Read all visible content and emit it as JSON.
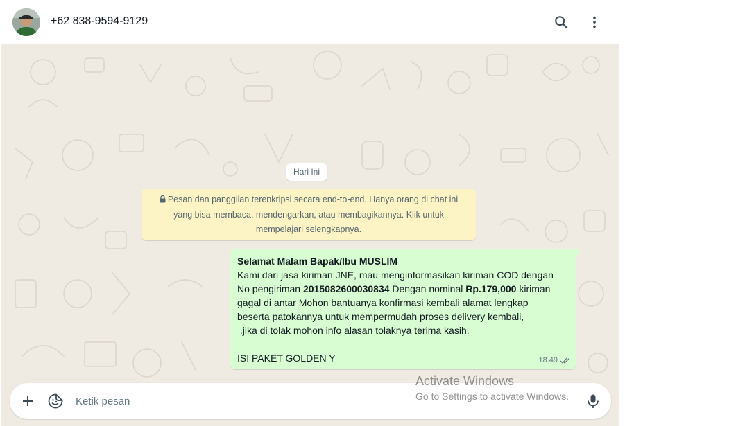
{
  "header": {
    "contact_name": "+62 838-9594-9129",
    "avatar_icon": "user-photo",
    "search_icon": "search-icon",
    "menu_icon": "more-vertical-icon"
  },
  "conversation": {
    "date_chip": "Hari Ini",
    "encryption_notice": {
      "icon": "lock-icon",
      "line1": "Pesan dan panggilan terenkripsi secara end-to-end. Hanya orang di chat ini",
      "line2": "yang bisa membaca, mendengarkan, atau membagikannya. Klik untuk",
      "line3": "mempelajari selengkapnya."
    },
    "message": {
      "greeting": "Selamat Malam Bapak/Ibu MUSLIM",
      "line1": "Kami dari jasa kiriman JNE, mau menginformasikan kiriman COD dengan",
      "line2_a": "No pengiriman ",
      "line2_b": "2015082600030834",
      "line2_c": " Dengan nominal ",
      "line2_d": "Rp.179,000",
      "line2_e": " kiriman",
      "line3": "gagal di antar Mohon bantuanya konfirmasi kembali alamat lengkap",
      "line4": "beserta patokannya untuk mempermudah proses delivery kembali,",
      "line5": " .jika di tolak mohon info alasan tolaknya terima kasih.",
      "line6": "ISI PAKET GOLDEN Y",
      "time": "18.49",
      "status": "read",
      "colors": {
        "bubble": "#d9fdd3",
        "notice": "#fdf4c5",
        "background": "#efeae2"
      }
    }
  },
  "composer": {
    "placeholder": "Ketik pesan",
    "value": "",
    "attach_icon": "plus-icon",
    "sticker_icon": "sticker-icon",
    "mic_icon": "microphone-icon"
  },
  "watermark": {
    "title": "Activate Windows",
    "subtitle": "Go to Settings to activate Windows."
  }
}
